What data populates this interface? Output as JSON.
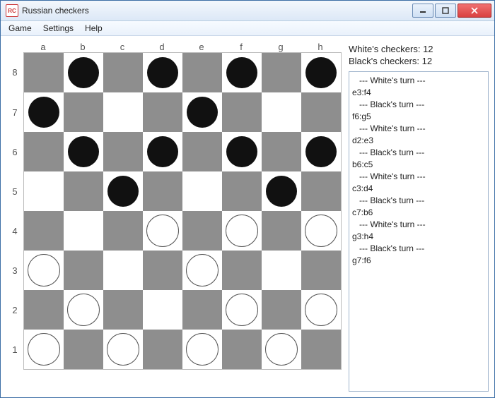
{
  "window": {
    "icon_text": "RC",
    "title": "Russian checkers"
  },
  "menu": {
    "game": "Game",
    "settings": "Settings",
    "help": "Help"
  },
  "board": {
    "cols": [
      "a",
      "b",
      "c",
      "d",
      "e",
      "f",
      "g",
      "h"
    ],
    "rows": [
      "8",
      "7",
      "6",
      "5",
      "4",
      "3",
      "2",
      "1"
    ],
    "pieces": [
      {
        "col": "b",
        "row": "8",
        "color": "black"
      },
      {
        "col": "d",
        "row": "8",
        "color": "black"
      },
      {
        "col": "f",
        "row": "8",
        "color": "black"
      },
      {
        "col": "h",
        "row": "8",
        "color": "black"
      },
      {
        "col": "a",
        "row": "7",
        "color": "black"
      },
      {
        "col": "e",
        "row": "7",
        "color": "black"
      },
      {
        "col": "b",
        "row": "6",
        "color": "black"
      },
      {
        "col": "d",
        "row": "6",
        "color": "black"
      },
      {
        "col": "f",
        "row": "6",
        "color": "black"
      },
      {
        "col": "h",
        "row": "6",
        "color": "black"
      },
      {
        "col": "c",
        "row": "5",
        "color": "black"
      },
      {
        "col": "g",
        "row": "5",
        "color": "black"
      },
      {
        "col": "d",
        "row": "4",
        "color": "white"
      },
      {
        "col": "f",
        "row": "4",
        "color": "white"
      },
      {
        "col": "h",
        "row": "4",
        "color": "white"
      },
      {
        "col": "a",
        "row": "3",
        "color": "white"
      },
      {
        "col": "e",
        "row": "3",
        "color": "white"
      },
      {
        "col": "b",
        "row": "2",
        "color": "white"
      },
      {
        "col": "f",
        "row": "2",
        "color": "white"
      },
      {
        "col": "h",
        "row": "2",
        "color": "white"
      },
      {
        "col": "a",
        "row": "1",
        "color": "white"
      },
      {
        "col": "c",
        "row": "1",
        "color": "white"
      },
      {
        "col": "e",
        "row": "1",
        "color": "white"
      },
      {
        "col": "g",
        "row": "1",
        "color": "white"
      }
    ]
  },
  "status": {
    "white_label": "White's checkers: 12",
    "black_label": "Black's checkers: 12"
  },
  "log": [
    {
      "header": "   --- White's turn ---",
      "move": "e3:f4"
    },
    {
      "header": "   --- Black's turn ---",
      "move": "f6:g5"
    },
    {
      "header": "   --- White's turn ---",
      "move": "d2:e3"
    },
    {
      "header": "   --- Black's turn ---",
      "move": "b6:c5"
    },
    {
      "header": "   --- White's turn ---",
      "move": "c3:d4"
    },
    {
      "header": "   --- Black's turn ---",
      "move": "c7:b6"
    },
    {
      "header": "   --- White's turn ---",
      "move": "g3:h4"
    },
    {
      "header": "   --- Black's turn ---",
      "move": "g7:f6"
    }
  ]
}
